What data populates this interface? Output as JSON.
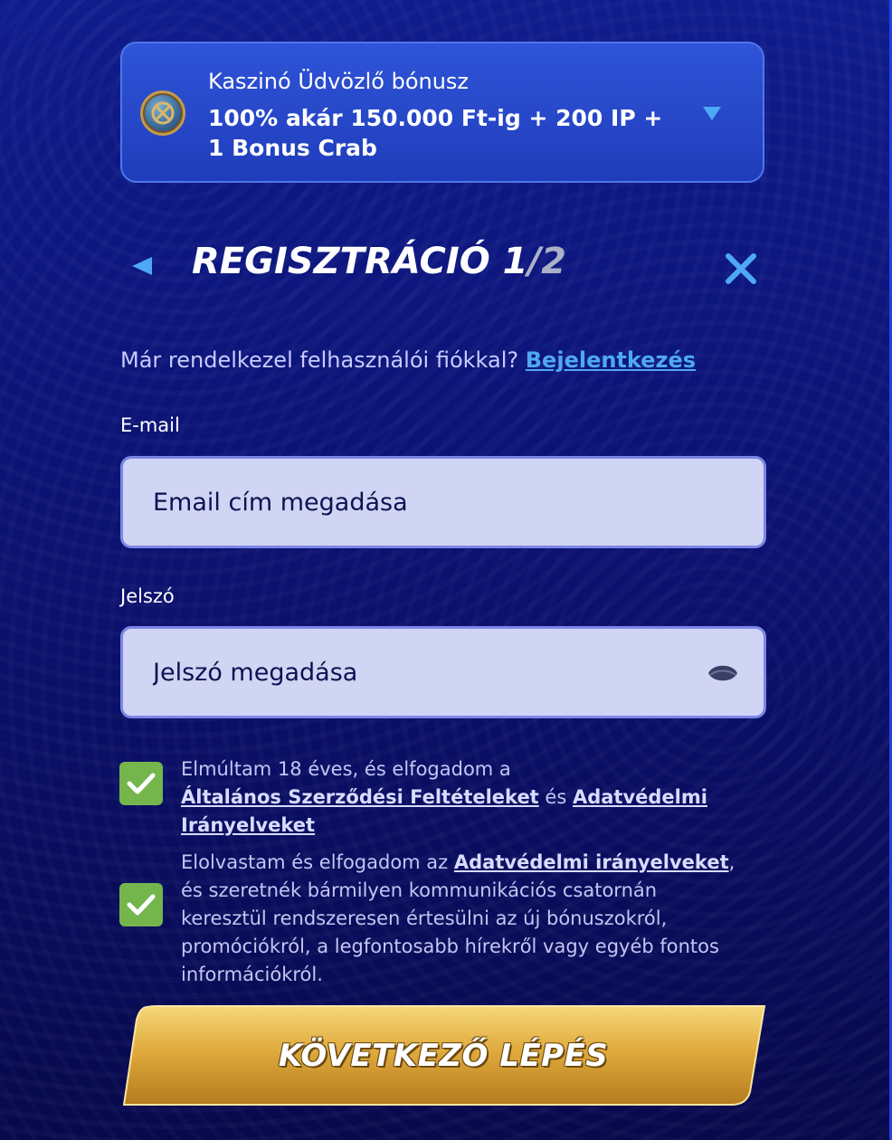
{
  "bonus": {
    "title": "Kaszinó Üdvözlő bónusz",
    "description": "100% akár 150.000 Ft-ig + 200 IP + 1 Bonus Crab",
    "coin_icon": "coin-icon",
    "dropdown_icon": "chevron-down-icon"
  },
  "header": {
    "title_main": "REGISZTRÁCIÓ 1",
    "title_sep_total": "/2",
    "back_icon": "back-arrow-icon",
    "close_icon": "close-icon"
  },
  "login": {
    "prompt": "Már rendelkezel felhasználói fiókkal?",
    "link": "Bejelentkezés"
  },
  "email": {
    "label": "E-mail",
    "placeholder": "Email cím megadása",
    "value": ""
  },
  "password": {
    "label": "Jelszó",
    "placeholder": "Jelszó megadása",
    "value": "",
    "toggle_icon": "eye-icon"
  },
  "consents": [
    {
      "checked": true,
      "text_before": "Elmúltam 18 éves, és elfogadom a",
      "link1": "Általános Szerződési Feltételeket",
      "text_mid": "és",
      "link2": "Adatvédelmi Irányelveket",
      "text_after": ""
    },
    {
      "checked": true,
      "text_before": "Elolvastam és elfogadom az",
      "link1": "Adatvédelmi irányelveket",
      "text_after": ", és szeretnék bármilyen kommunikációs csatornán keresztül rendszeresen értesülni az új bónuszokról, promóciókról, a legfontosabb hírekről vagy egyéb fontos információkról."
    }
  ],
  "next_button": {
    "label": "KÖVETKEZŐ LÉPÉS"
  },
  "colors": {
    "background": "#0c1478",
    "accent_blue": "#4da9f5",
    "checkbox_green": "#74b64c",
    "input_bg": "#d1d5f4",
    "button_gold": "#e6b94a"
  }
}
